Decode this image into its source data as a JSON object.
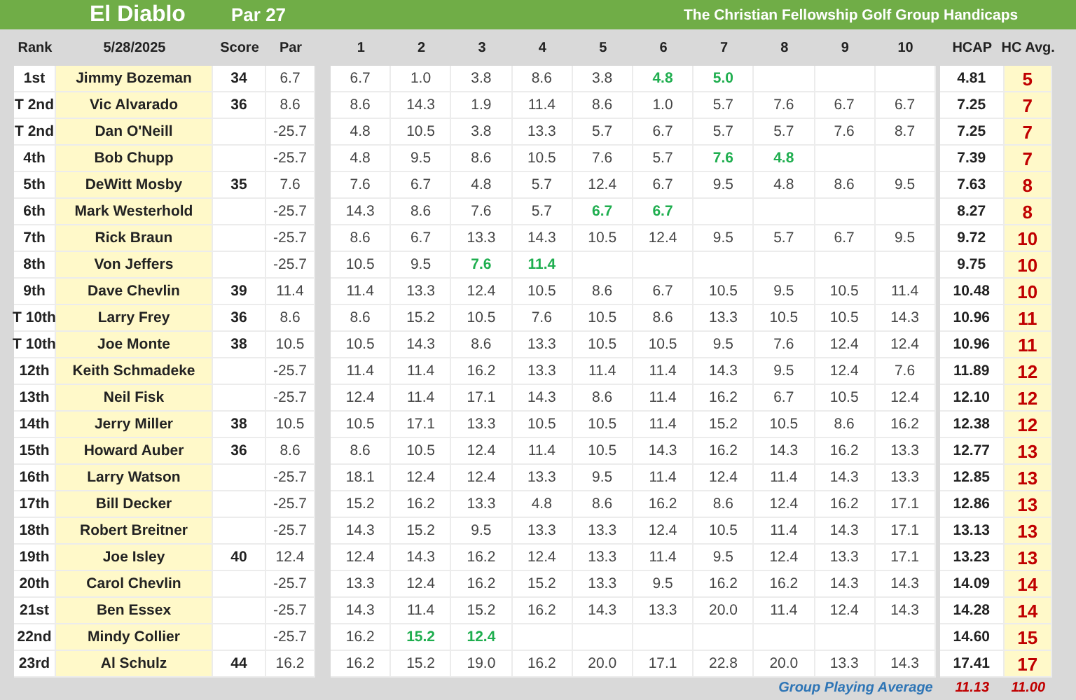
{
  "title_bar": {
    "course": "El Diablo",
    "par": "Par 27",
    "group_title": "The Christian Fellowship Golf Group Handicaps"
  },
  "columns": {
    "rank": "Rank",
    "date": "5/28/2025",
    "score": "Score",
    "par": "Par",
    "rounds": [
      "1",
      "2",
      "3",
      "4",
      "5",
      "6",
      "7",
      "8",
      "9",
      "10"
    ],
    "hcap": "HCAP",
    "hc_avg": "HC Avg."
  },
  "rows": [
    {
      "rank": "1st",
      "name": "Jimmy Bozeman",
      "score": "34",
      "par": "6.7",
      "rounds": [
        {
          "value": "6.7",
          "highlighted": false
        },
        {
          "value": "1.0",
          "highlighted": false
        },
        {
          "value": "3.8",
          "highlighted": false
        },
        {
          "value": "8.6",
          "highlighted": false
        },
        {
          "value": "3.8",
          "highlighted": false
        },
        {
          "value": "4.8",
          "highlighted": true
        },
        {
          "value": "5.0",
          "highlighted": true
        }
      ],
      "hcap": "4.81",
      "hc_avg": "5"
    },
    {
      "rank": "T 2nd",
      "name": "Vic Alvarado",
      "score": "36",
      "par": "8.6",
      "rounds": [
        {
          "value": "8.6",
          "highlighted": false
        },
        {
          "value": "14.3",
          "highlighted": false
        },
        {
          "value": "1.9",
          "highlighted": false
        },
        {
          "value": "11.4",
          "highlighted": false
        },
        {
          "value": "8.6",
          "highlighted": false
        },
        {
          "value": "1.0",
          "highlighted": false
        },
        {
          "value": "5.7",
          "highlighted": false
        },
        {
          "value": "7.6",
          "highlighted": false
        },
        {
          "value": "6.7",
          "highlighted": false
        },
        {
          "value": "6.7",
          "highlighted": false
        }
      ],
      "hcap": "7.25",
      "hc_avg": "7"
    },
    {
      "rank": "T 2nd",
      "name": "Dan O'Neill",
      "par": "-25.7",
      "rounds": [
        {
          "value": "4.8",
          "highlighted": false
        },
        {
          "value": "10.5",
          "highlighted": false
        },
        {
          "value": "3.8",
          "highlighted": false
        },
        {
          "value": "13.3",
          "highlighted": false
        },
        {
          "value": "5.7",
          "highlighted": false
        },
        {
          "value": "6.7",
          "highlighted": false
        },
        {
          "value": "5.7",
          "highlighted": false
        },
        {
          "value": "5.7",
          "highlighted": false
        },
        {
          "value": "7.6",
          "highlighted": false
        },
        {
          "value": "8.7",
          "highlighted": false
        }
      ],
      "hcap": "7.25",
      "hc_avg": "7"
    },
    {
      "rank": "4th",
      "name": "Bob Chupp",
      "par": "-25.7",
      "rounds": [
        {
          "value": "4.8",
          "highlighted": false
        },
        {
          "value": "9.5",
          "highlighted": false
        },
        {
          "value": "8.6",
          "highlighted": false
        },
        {
          "value": "10.5",
          "highlighted": false
        },
        {
          "value": "7.6",
          "highlighted": false
        },
        {
          "value": "5.7",
          "highlighted": false
        },
        {
          "value": "7.6",
          "highlighted": true
        },
        {
          "value": "4.8",
          "highlighted": true
        }
      ],
      "hcap": "7.39",
      "hc_avg": "7"
    },
    {
      "rank": "5th",
      "name": "DeWitt Mosby",
      "score": "35",
      "par": "7.6",
      "rounds": [
        {
          "value": "7.6",
          "highlighted": false
        },
        {
          "value": "6.7",
          "highlighted": false
        },
        {
          "value": "4.8",
          "highlighted": false
        },
        {
          "value": "5.7",
          "highlighted": false
        },
        {
          "value": "12.4",
          "highlighted": false
        },
        {
          "value": "6.7",
          "highlighted": false
        },
        {
          "value": "9.5",
          "highlighted": false
        },
        {
          "value": "4.8",
          "highlighted": false
        },
        {
          "value": "8.6",
          "highlighted": false
        },
        {
          "value": "9.5",
          "highlighted": false
        }
      ],
      "hcap": "7.63",
      "hc_avg": "8"
    },
    {
      "rank": "6th",
      "name": "Mark Westerhold",
      "par": "-25.7",
      "rounds": [
        {
          "value": "14.3",
          "highlighted": false
        },
        {
          "value": "8.6",
          "highlighted": false
        },
        {
          "value": "7.6",
          "highlighted": false
        },
        {
          "value": "5.7",
          "highlighted": false
        },
        {
          "value": "6.7",
          "highlighted": true
        },
        {
          "value": "6.7",
          "highlighted": true
        }
      ],
      "hcap": "8.27",
      "hc_avg": "8"
    },
    {
      "rank": "7th",
      "name": "Rick Braun",
      "par": "-25.7",
      "rounds": [
        {
          "value": "8.6",
          "highlighted": false
        },
        {
          "value": "6.7",
          "highlighted": false
        },
        {
          "value": "13.3",
          "highlighted": false
        },
        {
          "value": "14.3",
          "highlighted": false
        },
        {
          "value": "10.5",
          "highlighted": false
        },
        {
          "value": "12.4",
          "highlighted": false
        },
        {
          "value": "9.5",
          "highlighted": false
        },
        {
          "value": "5.7",
          "highlighted": false
        },
        {
          "value": "6.7",
          "highlighted": false
        },
        {
          "value": "9.5",
          "highlighted": false
        }
      ],
      "hcap": "9.72",
      "hc_avg": "10"
    },
    {
      "rank": "8th",
      "name": "Von Jeffers",
      "par": "-25.7",
      "rounds": [
        {
          "value": "10.5",
          "highlighted": false
        },
        {
          "value": "9.5",
          "highlighted": false
        },
        {
          "value": "7.6",
          "highlighted": true
        },
        {
          "value": "11.4",
          "highlighted": true
        }
      ],
      "hcap": "9.75",
      "hc_avg": "10"
    },
    {
      "rank": "9th",
      "name": "Dave Chevlin",
      "score": "39",
      "par": "11.4",
      "rounds": [
        {
          "value": "11.4",
          "highlighted": false
        },
        {
          "value": "13.3",
          "highlighted": false
        },
        {
          "value": "12.4",
          "highlighted": false
        },
        {
          "value": "10.5",
          "highlighted": false
        },
        {
          "value": "8.6",
          "highlighted": false
        },
        {
          "value": "6.7",
          "highlighted": false
        },
        {
          "value": "10.5",
          "highlighted": false
        },
        {
          "value": "9.5",
          "highlighted": false
        },
        {
          "value": "10.5",
          "highlighted": false
        },
        {
          "value": "11.4",
          "highlighted": false
        }
      ],
      "hcap": "10.48",
      "hc_avg": "10"
    },
    {
      "rank": "T 10th",
      "name": "Larry Frey",
      "score": "36",
      "par": "8.6",
      "rounds": [
        {
          "value": "8.6",
          "highlighted": false
        },
        {
          "value": "15.2",
          "highlighted": false
        },
        {
          "value": "10.5",
          "highlighted": false
        },
        {
          "value": "7.6",
          "highlighted": false
        },
        {
          "value": "10.5",
          "highlighted": false
        },
        {
          "value": "8.6",
          "highlighted": false
        },
        {
          "value": "13.3",
          "highlighted": false
        },
        {
          "value": "10.5",
          "highlighted": false
        },
        {
          "value": "10.5",
          "highlighted": false
        },
        {
          "value": "14.3",
          "highlighted": false
        }
      ],
      "hcap": "10.96",
      "hc_avg": "11"
    },
    {
      "rank": "T 10th",
      "name": "Joe Monte",
      "score": "38",
      "par": "10.5",
      "rounds": [
        {
          "value": "10.5",
          "highlighted": false
        },
        {
          "value": "14.3",
          "highlighted": false
        },
        {
          "value": "8.6",
          "highlighted": false
        },
        {
          "value": "13.3",
          "highlighted": false
        },
        {
          "value": "10.5",
          "highlighted": false
        },
        {
          "value": "10.5",
          "highlighted": false
        },
        {
          "value": "9.5",
          "highlighted": false
        },
        {
          "value": "7.6",
          "highlighted": false
        },
        {
          "value": "12.4",
          "highlighted": false
        },
        {
          "value": "12.4",
          "highlighted": false
        }
      ],
      "hcap": "10.96",
      "hc_avg": "11"
    },
    {
      "rank": "12th",
      "name": "Keith Schmadeke",
      "par": "-25.7",
      "rounds": [
        {
          "value": "11.4",
          "highlighted": false
        },
        {
          "value": "11.4",
          "highlighted": false
        },
        {
          "value": "16.2",
          "highlighted": false
        },
        {
          "value": "13.3",
          "highlighted": false
        },
        {
          "value": "11.4",
          "highlighted": false
        },
        {
          "value": "11.4",
          "highlighted": false
        },
        {
          "value": "14.3",
          "highlighted": false
        },
        {
          "value": "9.5",
          "highlighted": false
        },
        {
          "value": "12.4",
          "highlighted": false
        },
        {
          "value": "7.6",
          "highlighted": false
        }
      ],
      "hcap": "11.89",
      "hc_avg": "12"
    },
    {
      "rank": "13th",
      "name": "Neil Fisk",
      "par": "-25.7",
      "rounds": [
        {
          "value": "12.4",
          "highlighted": false
        },
        {
          "value": "11.4",
          "highlighted": false
        },
        {
          "value": "17.1",
          "highlighted": false
        },
        {
          "value": "14.3",
          "highlighted": false
        },
        {
          "value": "8.6",
          "highlighted": false
        },
        {
          "value": "11.4",
          "highlighted": false
        },
        {
          "value": "16.2",
          "highlighted": false
        },
        {
          "value": "6.7",
          "highlighted": false
        },
        {
          "value": "10.5",
          "highlighted": false
        },
        {
          "value": "12.4",
          "highlighted": false
        }
      ],
      "hcap": "12.10",
      "hc_avg": "12"
    },
    {
      "rank": "14th",
      "name": "Jerry Miller",
      "score": "38",
      "par": "10.5",
      "rounds": [
        {
          "value": "10.5",
          "highlighted": false
        },
        {
          "value": "17.1",
          "highlighted": false
        },
        {
          "value": "13.3",
          "highlighted": false
        },
        {
          "value": "10.5",
          "highlighted": false
        },
        {
          "value": "10.5",
          "highlighted": false
        },
        {
          "value": "11.4",
          "highlighted": false
        },
        {
          "value": "15.2",
          "highlighted": false
        },
        {
          "value": "10.5",
          "highlighted": false
        },
        {
          "value": "8.6",
          "highlighted": false
        },
        {
          "value": "16.2",
          "highlighted": false
        }
      ],
      "hcap": "12.38",
      "hc_avg": "12"
    },
    {
      "rank": "15th",
      "name": "Howard Auber",
      "score": "36",
      "par": "8.6",
      "rounds": [
        {
          "value": "8.6",
          "highlighted": false
        },
        {
          "value": "10.5",
          "highlighted": false
        },
        {
          "value": "12.4",
          "highlighted": false
        },
        {
          "value": "11.4",
          "highlighted": false
        },
        {
          "value": "10.5",
          "highlighted": false
        },
        {
          "value": "14.3",
          "highlighted": false
        },
        {
          "value": "16.2",
          "highlighted": false
        },
        {
          "value": "14.3",
          "highlighted": false
        },
        {
          "value": "16.2",
          "highlighted": false
        },
        {
          "value": "13.3",
          "highlighted": false
        }
      ],
      "hcap": "12.77",
      "hc_avg": "13"
    },
    {
      "rank": "16th",
      "name": "Larry Watson",
      "par": "-25.7",
      "rounds": [
        {
          "value": "18.1",
          "highlighted": false
        },
        {
          "value": "12.4",
          "highlighted": false
        },
        {
          "value": "12.4",
          "highlighted": false
        },
        {
          "value": "13.3",
          "highlighted": false
        },
        {
          "value": "9.5",
          "highlighted": false
        },
        {
          "value": "11.4",
          "highlighted": false
        },
        {
          "value": "12.4",
          "highlighted": false
        },
        {
          "value": "11.4",
          "highlighted": false
        },
        {
          "value": "14.3",
          "highlighted": false
        },
        {
          "value": "13.3",
          "highlighted": false
        }
      ],
      "hcap": "12.85",
      "hc_avg": "13"
    },
    {
      "rank": "17th",
      "name": "Bill Decker",
      "par": "-25.7",
      "rounds": [
        {
          "value": "15.2",
          "highlighted": false
        },
        {
          "value": "16.2",
          "highlighted": false
        },
        {
          "value": "13.3",
          "highlighted": false
        },
        {
          "value": "4.8",
          "highlighted": false
        },
        {
          "value": "8.6",
          "highlighted": false
        },
        {
          "value": "16.2",
          "highlighted": false
        },
        {
          "value": "8.6",
          "highlighted": false
        },
        {
          "value": "12.4",
          "highlighted": false
        },
        {
          "value": "16.2",
          "highlighted": false
        },
        {
          "value": "17.1",
          "highlighted": false
        }
      ],
      "hcap": "12.86",
      "hc_avg": "13"
    },
    {
      "rank": "18th",
      "name": "Robert Breitner",
      "par": "-25.7",
      "rounds": [
        {
          "value": "14.3",
          "highlighted": false
        },
        {
          "value": "15.2",
          "highlighted": false
        },
        {
          "value": "9.5",
          "highlighted": false
        },
        {
          "value": "13.3",
          "highlighted": false
        },
        {
          "value": "13.3",
          "highlighted": false
        },
        {
          "value": "12.4",
          "highlighted": false
        },
        {
          "value": "10.5",
          "highlighted": false
        },
        {
          "value": "11.4",
          "highlighted": false
        },
        {
          "value": "14.3",
          "highlighted": false
        },
        {
          "value": "17.1",
          "highlighted": false
        }
      ],
      "hcap": "13.13",
      "hc_avg": "13"
    },
    {
      "rank": "19th",
      "name": "Joe Isley",
      "score": "40",
      "par": "12.4",
      "rounds": [
        {
          "value": "12.4",
          "highlighted": false
        },
        {
          "value": "14.3",
          "highlighted": false
        },
        {
          "value": "16.2",
          "highlighted": false
        },
        {
          "value": "12.4",
          "highlighted": false
        },
        {
          "value": "13.3",
          "highlighted": false
        },
        {
          "value": "11.4",
          "highlighted": false
        },
        {
          "value": "9.5",
          "highlighted": false
        },
        {
          "value": "12.4",
          "highlighted": false
        },
        {
          "value": "13.3",
          "highlighted": false
        },
        {
          "value": "17.1",
          "highlighted": false
        }
      ],
      "hcap": "13.23",
      "hc_avg": "13"
    },
    {
      "rank": "20th",
      "name": "Carol Chevlin",
      "par": "-25.7",
      "rounds": [
        {
          "value": "13.3",
          "highlighted": false
        },
        {
          "value": "12.4",
          "highlighted": false
        },
        {
          "value": "16.2",
          "highlighted": false
        },
        {
          "value": "15.2",
          "highlighted": false
        },
        {
          "value": "13.3",
          "highlighted": false
        },
        {
          "value": "9.5",
          "highlighted": false
        },
        {
          "value": "16.2",
          "highlighted": false
        },
        {
          "value": "16.2",
          "highlighted": false
        },
        {
          "value": "14.3",
          "highlighted": false
        },
        {
          "value": "14.3",
          "highlighted": false
        }
      ],
      "hcap": "14.09",
      "hc_avg": "14"
    },
    {
      "rank": "21st",
      "name": "Ben Essex",
      "par": "-25.7",
      "rounds": [
        {
          "value": "14.3",
          "highlighted": false
        },
        {
          "value": "11.4",
          "highlighted": false
        },
        {
          "value": "15.2",
          "highlighted": false
        },
        {
          "value": "16.2",
          "highlighted": false
        },
        {
          "value": "14.3",
          "highlighted": false
        },
        {
          "value": "13.3",
          "highlighted": false
        },
        {
          "value": "20.0",
          "highlighted": false
        },
        {
          "value": "11.4",
          "highlighted": false
        },
        {
          "value": "12.4",
          "highlighted": false
        },
        {
          "value": "14.3",
          "highlighted": false
        }
      ],
      "hcap": "14.28",
      "hc_avg": "14"
    },
    {
      "rank": "22nd",
      "name": "Mindy Collier",
      "par": "-25.7",
      "rounds": [
        {
          "value": "16.2",
          "highlighted": false
        },
        {
          "value": "15.2",
          "highlighted": true
        },
        {
          "value": "12.4",
          "highlighted": true
        }
      ],
      "hcap": "14.60",
      "hc_avg": "15"
    },
    {
      "rank": "23rd",
      "name": "Al Schulz",
      "score": "44",
      "par": "16.2",
      "rounds": [
        {
          "value": "16.2",
          "highlighted": false
        },
        {
          "value": "15.2",
          "highlighted": false
        },
        {
          "value": "19.0",
          "highlighted": false
        },
        {
          "value": "16.2",
          "highlighted": false
        },
        {
          "value": "20.0",
          "highlighted": false
        },
        {
          "value": "17.1",
          "highlighted": false
        },
        {
          "value": "22.8",
          "highlighted": false
        },
        {
          "value": "20.0",
          "highlighted": false
        },
        {
          "value": "13.3",
          "highlighted": false
        },
        {
          "value": "14.3",
          "highlighted": false
        }
      ],
      "hcap": "17.41",
      "hc_avg": "17"
    }
  ],
  "footer": {
    "label": "Group Playing Average",
    "hcap_average": "11.13",
    "hc_avg_average": "11.00"
  }
}
